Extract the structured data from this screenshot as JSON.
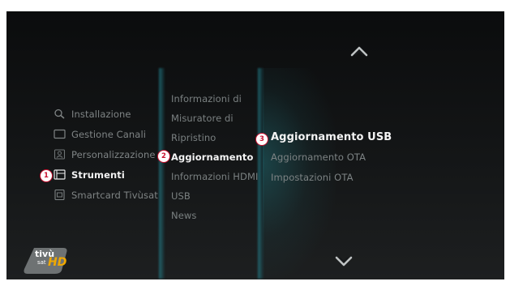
{
  "menu_level1": [
    {
      "label": "Installazione",
      "icon": "search-icon"
    },
    {
      "label": "Gestione Canali",
      "icon": "tv-icon"
    },
    {
      "label": "Personalizzazione",
      "icon": "user-icon"
    },
    {
      "label": "Strumenti",
      "icon": "tools-icon",
      "selected": true,
      "badge": "1"
    },
    {
      "label": "Smartcard Tivùsat",
      "icon": "smartcard-icon"
    }
  ],
  "menu_level2": [
    {
      "label": "Informazioni di"
    },
    {
      "label": "Misuratore di"
    },
    {
      "label": "Ripristino"
    },
    {
      "label": "Aggiornamento",
      "selected": true,
      "badge": "2"
    },
    {
      "label": "Informazioni HDMI"
    },
    {
      "label": "USB"
    },
    {
      "label": "News"
    }
  ],
  "menu_level3": [
    {
      "label": "Aggiornamento USB",
      "selected": true,
      "badge": "3"
    },
    {
      "label": "Aggiornamento OTA"
    },
    {
      "label": "Impostazioni OTA"
    }
  ],
  "logo": {
    "brand": "tivù",
    "sub": "sat",
    "hd": "HD"
  },
  "icons": {
    "scroll_up": "chevron-up-icon",
    "scroll_down": "chevron-down-icon"
  },
  "colors": {
    "badge_border": "#c8102e",
    "accent_glow": "#28a0af",
    "selected_text": "#f4f4f4"
  }
}
